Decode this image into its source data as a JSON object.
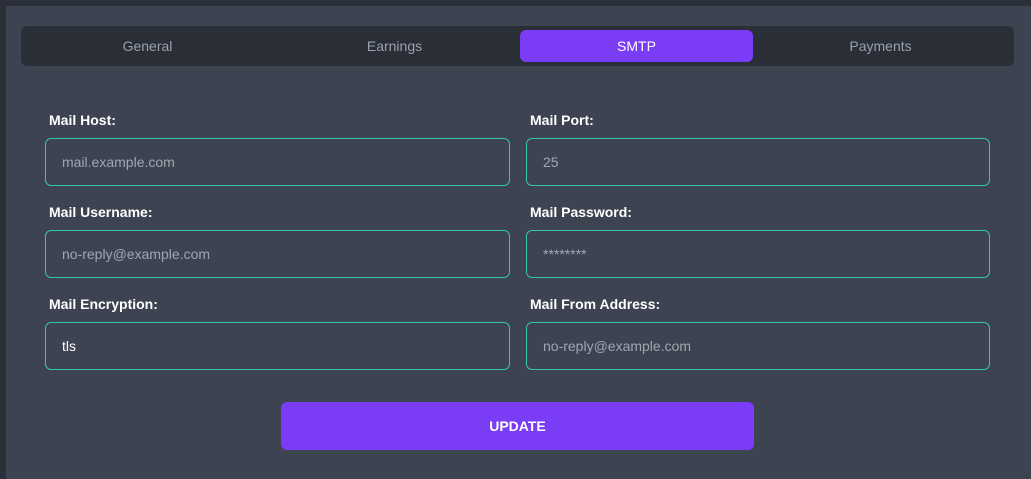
{
  "tabs": {
    "general": "General",
    "earnings": "Earnings",
    "smtp": "SMTP",
    "payments": "Payments",
    "active": "SMTP"
  },
  "form": {
    "mail_host": {
      "label": "Mail Host:",
      "placeholder": "mail.example.com",
      "value": ""
    },
    "mail_port": {
      "label": "Mail Port:",
      "placeholder": "25",
      "value": ""
    },
    "mail_username": {
      "label": "Mail Username:",
      "placeholder": "no-reply@example.com",
      "value": ""
    },
    "mail_password": {
      "label": "Mail Password:",
      "placeholder": "********",
      "value": ""
    },
    "mail_encryption": {
      "label": "Mail Encryption:",
      "placeholder": "",
      "value": "tls"
    },
    "mail_from_address": {
      "label": "Mail From Address:",
      "placeholder": "no-reply@example.com",
      "value": ""
    }
  },
  "update_button": "UPDATE",
  "colors": {
    "accent": "#7b3cf5",
    "input_border": "#35c4b0",
    "panel_bg": "#3d4350",
    "tabbar_bg": "#2a2e36"
  }
}
